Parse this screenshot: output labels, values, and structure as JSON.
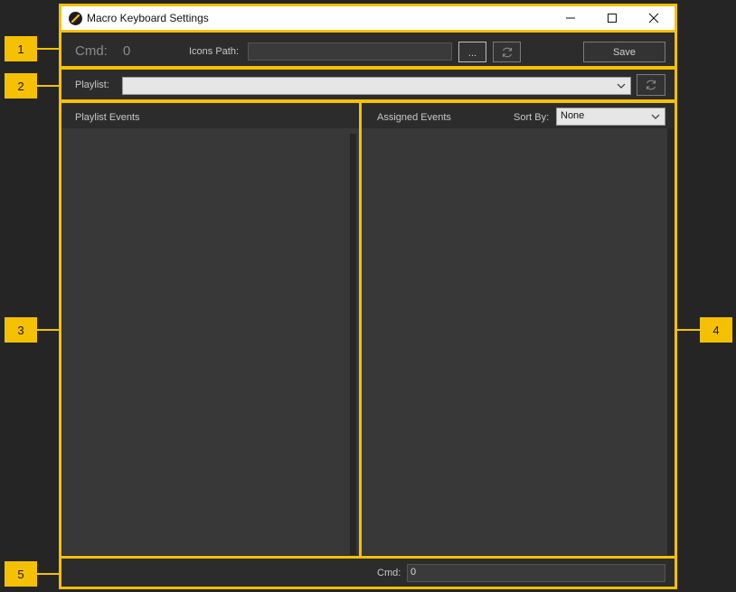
{
  "window": {
    "title": "Macro Keyboard Settings",
    "controls": {
      "minimize_icon": "minimize-icon",
      "maximize_icon": "maximize-icon",
      "close_icon": "close-icon"
    }
  },
  "callouts": {
    "c1": "1",
    "c2": "2",
    "c3": "3",
    "c4": "4",
    "c5": "5"
  },
  "toolbar": {
    "cmd_label": "Cmd:",
    "cmd_value": "0",
    "icons_path_label": "Icons Path:",
    "icons_path_value": "",
    "browse_label": "...",
    "save_label": "Save"
  },
  "playlist": {
    "label": "Playlist:",
    "value": ""
  },
  "playlist_events": {
    "header": "Playlist Events"
  },
  "assigned_events": {
    "header": "Assigned Events",
    "sort_label": "Sort By:",
    "sort_value": "None"
  },
  "footer": {
    "cmd_label": "Cmd:",
    "cmd_value": "0"
  },
  "colors": {
    "accent": "#f5c000",
    "background": "#252526",
    "panel": "#383838"
  }
}
